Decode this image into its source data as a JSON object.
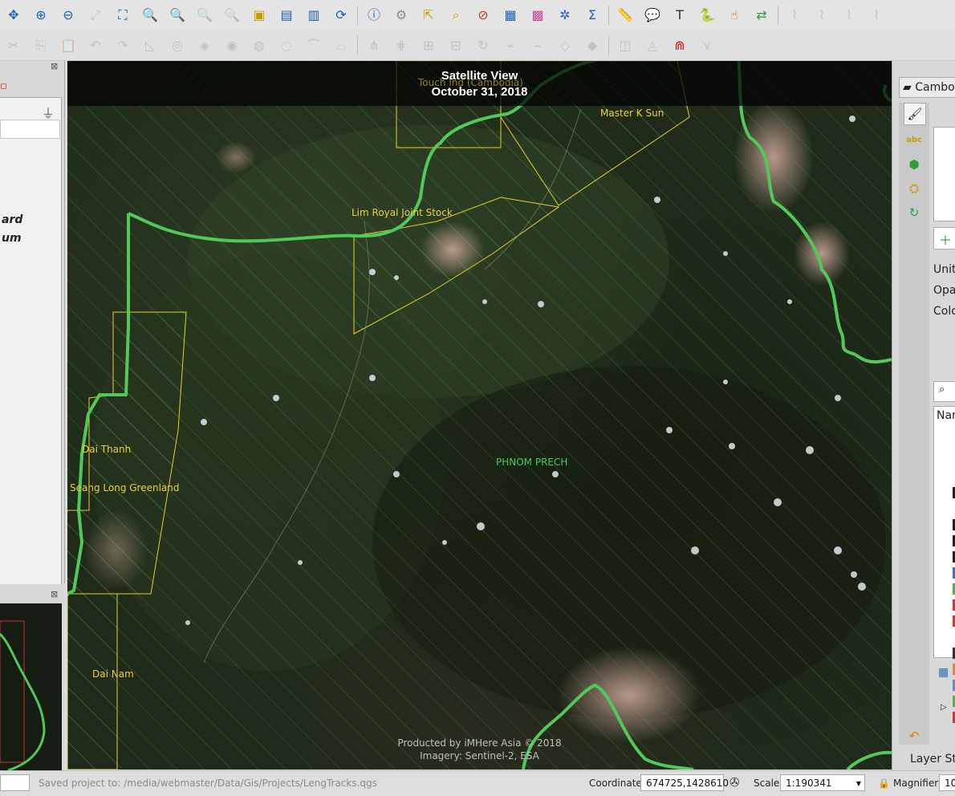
{
  "toolbar_primary": [
    {
      "icon": "pan-icon",
      "glyph": "✥",
      "color": "#1d5fb8"
    },
    {
      "icon": "zoom-in-icon",
      "glyph": "⊕",
      "color": "#1d5fb8"
    },
    {
      "icon": "zoom-out-icon",
      "glyph": "⊖",
      "color": "#1d5fb8"
    },
    {
      "icon": "zoom-full-icon",
      "glyph": "⤢",
      "color": "#8a8a8a",
      "dim": true
    },
    {
      "icon": "zoom-selection-icon",
      "glyph": "⛶",
      "color": "#1d5fb8"
    },
    {
      "icon": "zoom-layer-icon",
      "glyph": "🔍",
      "color": "#c79b00"
    },
    {
      "icon": "zoom-native-icon",
      "glyph": "🔍",
      "color": "#1d5fb8"
    },
    {
      "icon": "zoom-last-icon",
      "glyph": "🔍",
      "color": "#8a8a8a",
      "dim": true
    },
    {
      "icon": "zoom-next-icon",
      "glyph": "🔍",
      "color": "#8a8a8a",
      "dim": true
    },
    {
      "icon": "new-bookmark-icon",
      "glyph": "▣",
      "color": "#c79b00"
    },
    {
      "icon": "show-bookmarks-icon",
      "glyph": "▤",
      "color": "#1d5fb8"
    },
    {
      "icon": "new-map-view-icon",
      "glyph": "▥",
      "color": "#1d5fb8"
    },
    {
      "icon": "refresh-icon",
      "glyph": "⟳",
      "color": "#1d5fb8"
    },
    {
      "icon": "identify-icon",
      "glyph": "ⓘ",
      "color": "#1d5fb8"
    },
    {
      "icon": "action-icon",
      "glyph": "⚙",
      "color": "#8a8a8a"
    },
    {
      "icon": "select-features-icon",
      "glyph": "⇱",
      "color": "#c79b00"
    },
    {
      "icon": "select-value-icon",
      "glyph": "⌕",
      "color": "#c79b00"
    },
    {
      "icon": "deselect-icon",
      "glyph": "⊘",
      "color": "#d43a2a"
    },
    {
      "icon": "attribute-table-icon",
      "glyph": "▦",
      "color": "#1d5fb8"
    },
    {
      "icon": "field-calculator-icon",
      "glyph": "▩",
      "color": "#c24a9a"
    },
    {
      "icon": "processing-toolbox-icon",
      "glyph": "✲",
      "color": "#1d5fb8"
    },
    {
      "icon": "statistics-icon",
      "glyph": "Σ",
      "color": "#1d5fb8"
    },
    {
      "icon": "measure-icon",
      "glyph": "📏",
      "color": "#666"
    },
    {
      "icon": "map-tips-icon",
      "glyph": "💬",
      "color": "#e0b400"
    },
    {
      "icon": "text-annotation-icon",
      "glyph": "T",
      "color": "#333"
    },
    {
      "icon": "python-console-icon",
      "glyph": "🐍",
      "color": "#2b6cb3"
    },
    {
      "icon": "pointer-icon",
      "glyph": "☝",
      "color": "#c76e00"
    },
    {
      "icon": "layer-sync-icon",
      "glyph": "⇄",
      "color": "#2e9e3e"
    },
    {
      "icon": "disabled-tool-1-icon",
      "glyph": "⌇",
      "color": "#8a8a8a",
      "dim": true
    },
    {
      "icon": "disabled-tool-2-icon",
      "glyph": "⌇",
      "color": "#8a8a8a",
      "dim": true
    },
    {
      "icon": "disabled-tool-3-icon",
      "glyph": "⌇",
      "color": "#8a8a8a",
      "dim": true
    },
    {
      "icon": "disabled-tool-4-icon",
      "glyph": "⌇",
      "color": "#8a8a8a",
      "dim": true
    }
  ],
  "toolbar_secondary": [
    {
      "icon": "cut-features-icon",
      "glyph": "✂",
      "color": "#8a8a8a",
      "dim": true
    },
    {
      "icon": "copy-features-icon",
      "glyph": "⎘",
      "color": "#8a8a8a",
      "dim": true
    },
    {
      "icon": "paste-features-icon",
      "glyph": "📋",
      "color": "#8a8a8a",
      "dim": true
    },
    {
      "icon": "undo-icon",
      "glyph": "↶",
      "color": "#8a8a8a",
      "dim": true
    },
    {
      "icon": "redo-icon",
      "glyph": "↷",
      "color": "#8a8a8a",
      "dim": true
    },
    {
      "icon": "digitize-shape-icon",
      "glyph": "◺",
      "color": "#8a8a8a",
      "dim": true
    },
    {
      "icon": "add-ring-icon",
      "glyph": "◎",
      "color": "#8a8a8a",
      "dim": true
    },
    {
      "icon": "add-part-icon",
      "glyph": "◈",
      "color": "#8a8a8a",
      "dim": true
    },
    {
      "icon": "fill-ring-icon",
      "glyph": "◉",
      "color": "#8a8a8a",
      "dim": true
    },
    {
      "icon": "delete-ring-icon",
      "glyph": "◍",
      "color": "#8a8a8a",
      "dim": true
    },
    {
      "icon": "delete-part-icon",
      "glyph": "◌",
      "color": "#8a8a8a",
      "dim": true
    },
    {
      "icon": "reshape-icon",
      "glyph": "⌒",
      "color": "#8a8a8a",
      "dim": true
    },
    {
      "icon": "offset-curve-icon",
      "glyph": "⌓",
      "color": "#8a8a8a",
      "dim": true
    },
    {
      "icon": "split-features-icon",
      "glyph": "⋔",
      "color": "#8a8a8a",
      "dim": true
    },
    {
      "icon": "split-parts-icon",
      "glyph": "⋕",
      "color": "#8a8a8a",
      "dim": true
    },
    {
      "icon": "merge-features-icon",
      "glyph": "⊞",
      "color": "#8a8a8a",
      "dim": true
    },
    {
      "icon": "merge-attributes-icon",
      "glyph": "⊟",
      "color": "#8a8a8a",
      "dim": true
    },
    {
      "icon": "rotate-label-icon",
      "glyph": "↻",
      "color": "#8a8a8a",
      "dim": true
    },
    {
      "icon": "simplify-icon",
      "glyph": "⌁",
      "color": "#8a8a8a",
      "dim": true
    },
    {
      "icon": "curve-tool-icon",
      "glyph": "⌢",
      "color": "#8a8a8a",
      "dim": true
    },
    {
      "icon": "vertex-tool-icon",
      "glyph": "◇",
      "color": "#8a8a8a",
      "dim": true
    },
    {
      "icon": "label-tool-icon",
      "glyph": "◆",
      "color": "#8a8a8a",
      "dim": true
    },
    {
      "icon": "diagram-tool-icon",
      "glyph": "◫",
      "color": "#8a8a8a",
      "dim": true
    },
    {
      "icon": "annotation-tool-icon",
      "glyph": "◬",
      "color": "#8a8a8a",
      "dim": true
    },
    {
      "icon": "magnet-icon",
      "glyph": "⋒",
      "color": "#c21f1f"
    },
    {
      "icon": "snapping-icon",
      "glyph": "⋎",
      "color": "#8a8a8a",
      "dim": true
    }
  ],
  "map": {
    "title_line1": "Satellite View",
    "title_line2": "October 31, 2018",
    "labels": {
      "touch": "Touch Ind (Cambodia)",
      "master_k_sun": "Master K Sun",
      "lim_royal": "Lim Royal Joint Stock",
      "dai_thanh": "Dai Thanh",
      "seang_long": "Seang Long Greenland",
      "phnom_prech": "PHNOM PRECH",
      "dai_nam": "Dai Nam"
    },
    "credit_line1": "Producted by iMHere Asia © 2018",
    "credit_line2": "Imagery: Sentinel-2, ESA",
    "colors": {
      "boundary": "#52c75a",
      "concession": "#e6cf2a",
      "hatch": "#6cc26a"
    }
  },
  "left_panel": {
    "cut_text_1": "ard",
    "cut_text_2": "um"
  },
  "right_panel": {
    "tab_title": "Cambo",
    "unit_label": "Unit",
    "opacity_label": "Opa",
    "color_label": "Colo",
    "name_header": "Nar",
    "layer_styling_tab": "Layer Styl",
    "swatches": [
      "#222222",
      "#ffffff",
      "#222222",
      "#222222",
      "#222222",
      "#3a6fd8",
      "#3fbf3f",
      "#e23030",
      "#e23030",
      "#ffffff",
      "#333333",
      "#e8892a",
      "#5a8fd8",
      "#3fbf3f",
      "#e23030"
    ]
  },
  "status": {
    "message": "Saved project to: /media/webmaster/Data/Gis/Projects/LengTracks.qgs",
    "coordinate_label": "Coordinate",
    "coordinate_value": "674725,1428610",
    "scale_label": "Scale",
    "scale_value": "1:190341",
    "magnifier_label": "Magnifier",
    "magnifier_value": "10"
  }
}
